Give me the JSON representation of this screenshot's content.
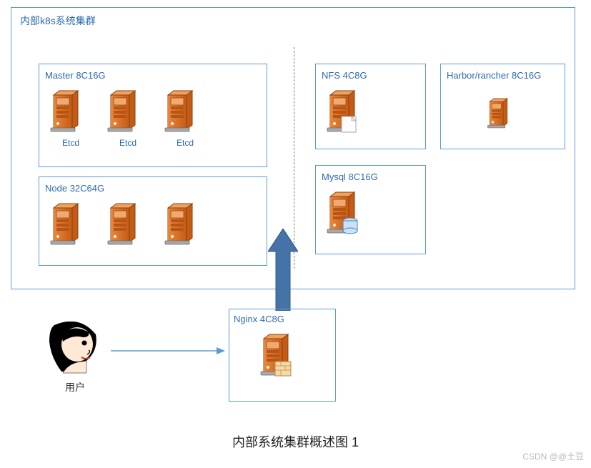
{
  "outer": {
    "title": "内部k8s系统集群"
  },
  "master": {
    "title": "Master 8C16G",
    "etcd": "Etcd"
  },
  "node": {
    "title": "Node   32C64G"
  },
  "nfs": {
    "title": "NFS  4C8G"
  },
  "harbor": {
    "title": "Harbor/rancher 8C16G"
  },
  "mysql": {
    "title": "Mysql 8C16G"
  },
  "nginx": {
    "title": "Nginx 4C8G"
  },
  "user": {
    "label": "用户"
  },
  "caption": "内部系统集群概述图  1",
  "watermark": "CSDN @@土豆"
}
